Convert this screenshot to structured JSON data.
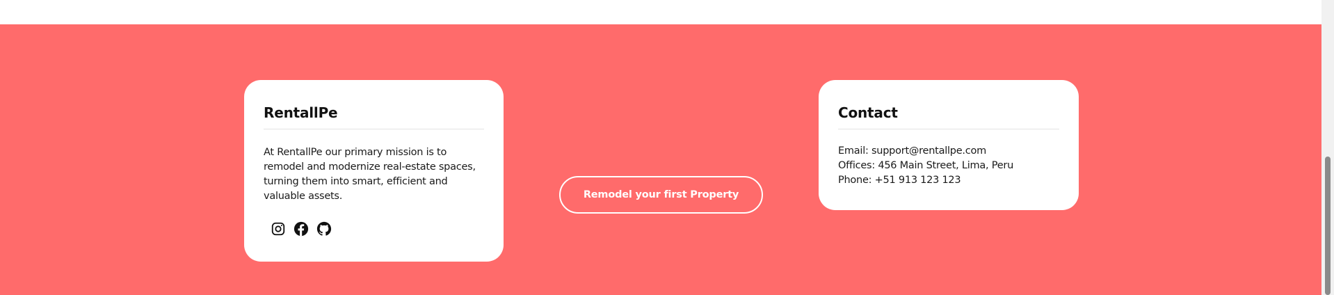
{
  "about": {
    "title": "RentallPe",
    "description": "At RentallPe our primary mission is to remodel and modernize real-estate spaces, turning them into smart, efficient and valuable assets.",
    "social": [
      "instagram-icon",
      "facebook-icon",
      "github-icon"
    ]
  },
  "cta": {
    "label": "Remodel your first Property"
  },
  "contact": {
    "title": "Contact",
    "email": "Email: support@rentallpe.com",
    "offices": "Offices: 456 Main Street, Lima, Peru",
    "phone": "Phone: +51 913 123 123"
  },
  "colors": {
    "footer_bg": "#ff6b6b",
    "card_bg": "#ffffff",
    "text": "#111111"
  }
}
